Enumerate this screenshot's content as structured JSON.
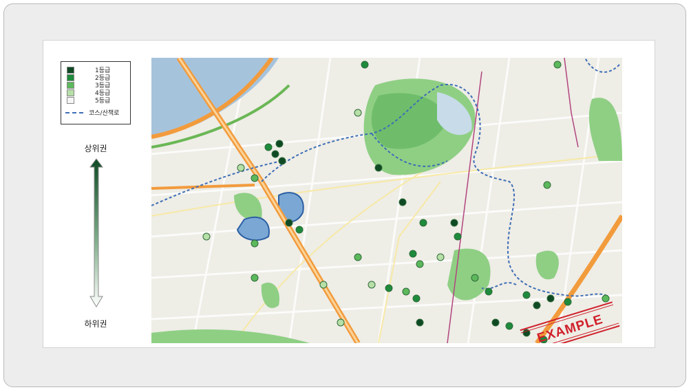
{
  "legend": {
    "grades": [
      {
        "label": "1등급",
        "color": "#0f4a25"
      },
      {
        "label": "2등급",
        "color": "#1e8a3c"
      },
      {
        "label": "3등급",
        "color": "#5cb85c"
      },
      {
        "label": "4등급",
        "color": "#b7dfa8"
      },
      {
        "label": "5등급",
        "color": "#f5f5f5"
      }
    ],
    "course_label": "코스/산책로",
    "course_color": "#3d6db5"
  },
  "scale": {
    "top_label": "상위권",
    "bottom_label": "하위권"
  },
  "map": {
    "watermark": "EXAMPLE",
    "watermark_color": "#d0202b"
  }
}
